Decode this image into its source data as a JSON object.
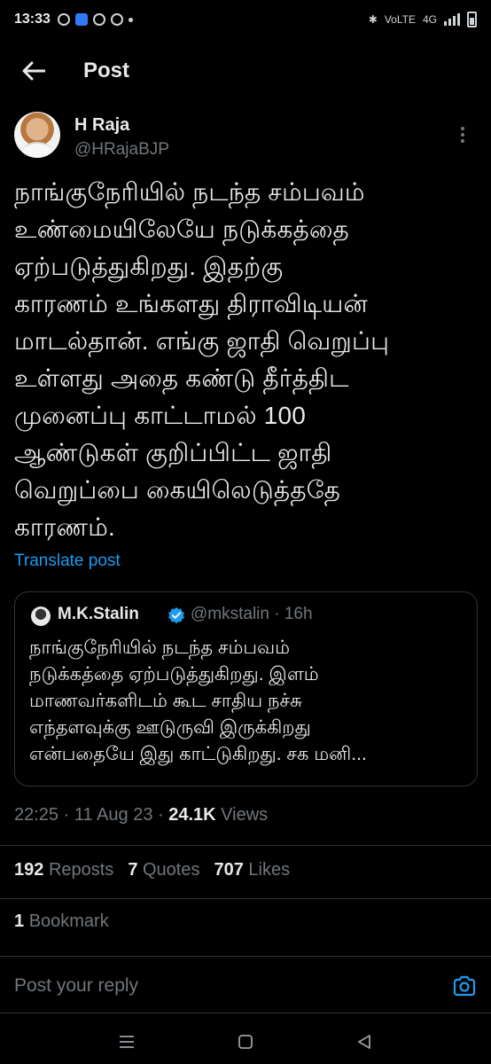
{
  "status_bar": {
    "time": "13:33",
    "network_label": "4G",
    "volte_label": "VoLTE"
  },
  "header": {
    "title": "Post"
  },
  "post": {
    "author_name": "H Raja",
    "author_handle": "@HRajaBJP",
    "text_lines": [
      "நாங்குநேரியில் நடந்த சம்பவம்",
      "உண்மையிலேயே நடுக்கத்தை",
      "ஏற்படுத்துகிறது. இதற்கு",
      "காரணம் உங்களது திராவிடியன்",
      "மாடல்தான். எங்கு ஜாதி வெறுப்பு",
      "உள்ளது அதை கண்டு தீர்த்திட",
      "முனைப்பு காட்டாமல் 100",
      "ஆண்டுகள் குறிப்பிட்ட ஜாதி",
      "வெறுப்பை கையிலெடுத்ததே",
      "காரணம்."
    ],
    "translate_label": "Translate post",
    "time": "22:25",
    "date": "11 Aug 23",
    "views_count": "24.1K",
    "views_label": "Views"
  },
  "quote": {
    "name": "M.K.Stalin",
    "handle_time": "@mkstalin · 16h",
    "text_lines": [
      "நாங்குநேரியில் நடந்த சம்பவம்",
      "நடுக்கத்தை ஏற்படுத்துகிறது. இளம்",
      "மாணவர்களிடம் கூட சாதிய நச்சு",
      "எந்தளவுக்கு ஊடுருவி இருக்கிறது",
      "என்பதையே இது காட்டுகிறது. சக மனி..."
    ]
  },
  "stats": {
    "reposts_count": "192",
    "reposts_label": "Reposts",
    "quotes_count": "7",
    "quotes_label": "Quotes",
    "likes_count": "707",
    "likes_label": "Likes",
    "bookmarks_count": "1",
    "bookmarks_label": "Bookmark"
  },
  "reply": {
    "placeholder": "Post your reply"
  },
  "colors": {
    "background": "#000000",
    "text": "#e7e9ea",
    "secondary": "#71767b",
    "accent": "#1d9bf0",
    "divider": "#2f3336"
  },
  "icons": [
    "back-arrow-icon",
    "more-vertical-icon",
    "verified-icon",
    "camera-icon",
    "nav-menu-icon",
    "nav-home-icon",
    "nav-back-icon"
  ]
}
